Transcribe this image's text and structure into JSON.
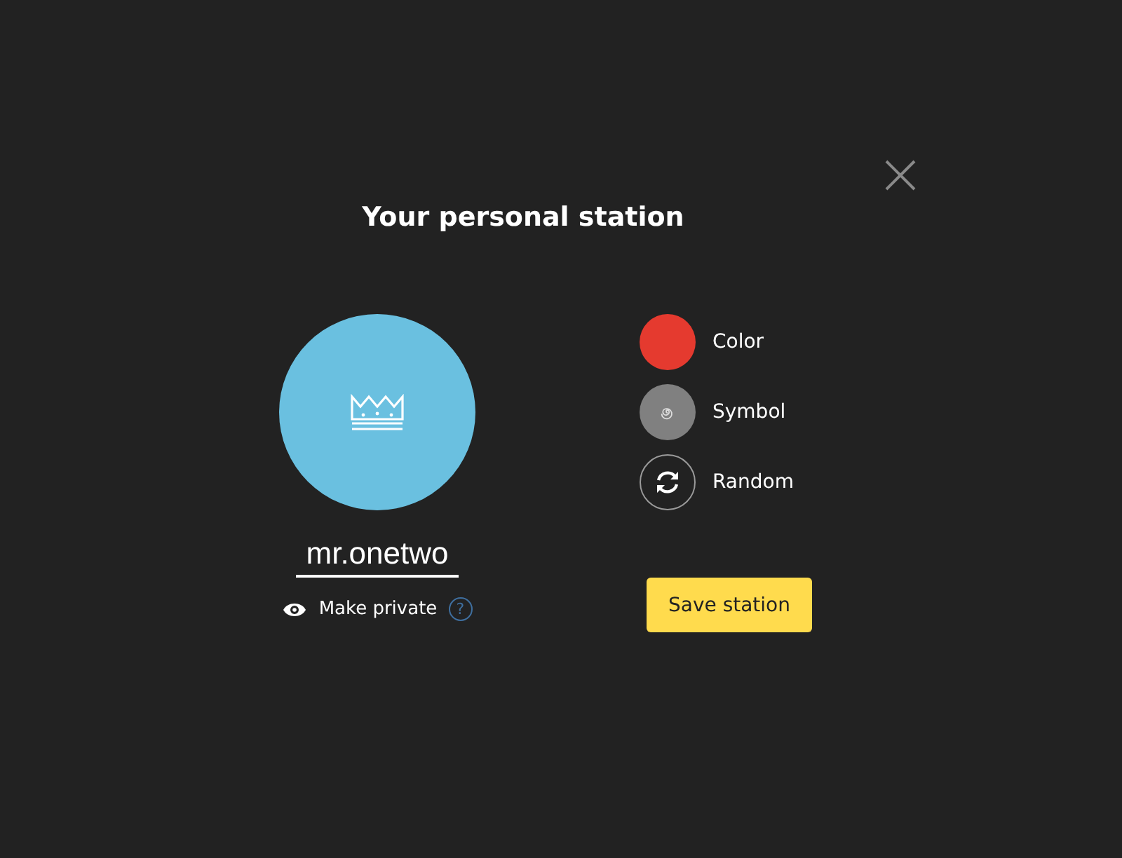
{
  "dialog": {
    "title": "Your personal station"
  },
  "avatar": {
    "color": "#6ac0e0"
  },
  "name_field": {
    "value": "mr.onetwo"
  },
  "privacy": {
    "label": "Make private",
    "help": "?"
  },
  "options": [
    {
      "kind": "color",
      "label": "Color",
      "color": "#e53a2f"
    },
    {
      "kind": "symbol",
      "label": "Symbol",
      "color": "#808080"
    },
    {
      "kind": "random",
      "label": "Random"
    }
  ],
  "buttons": [
    {
      "label": "Save station"
    }
  ]
}
